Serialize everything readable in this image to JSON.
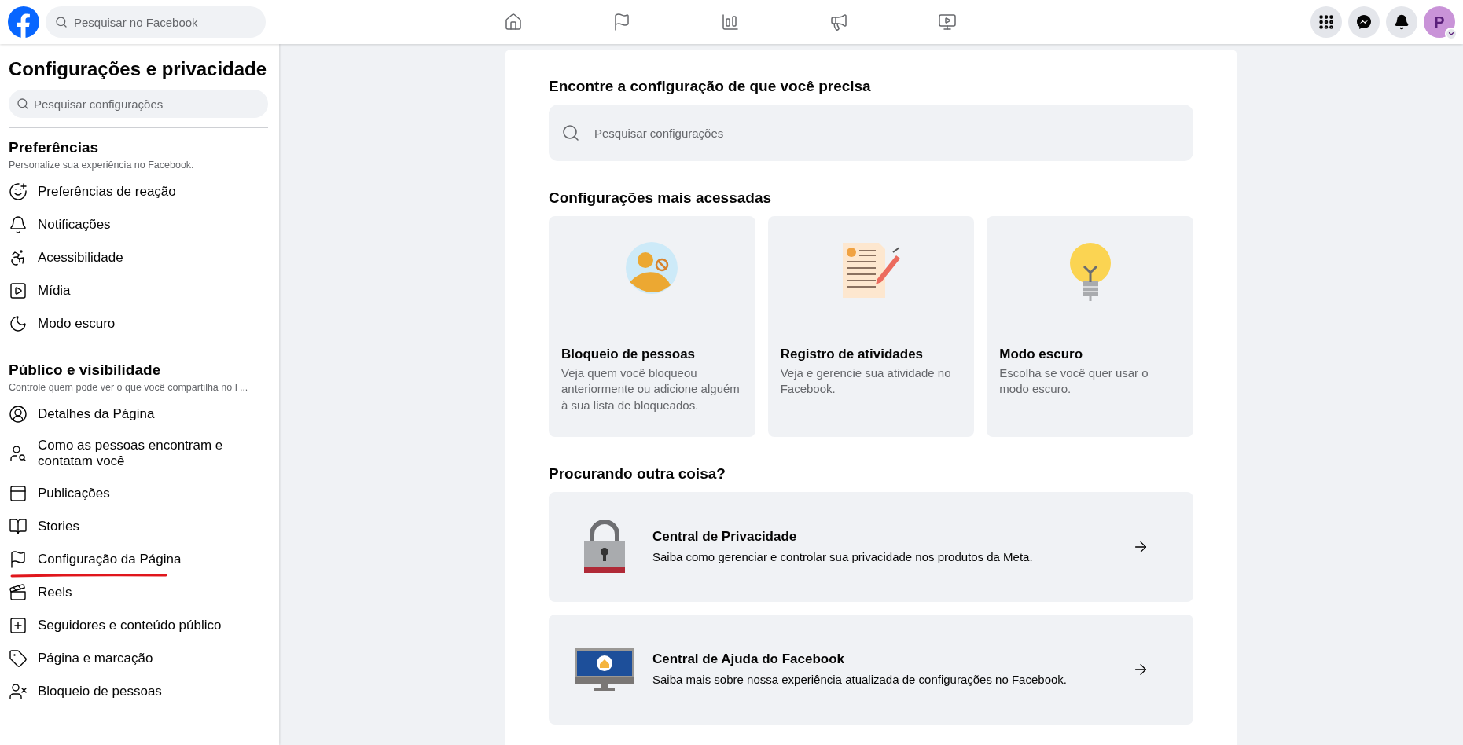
{
  "topbar": {
    "search": {
      "placeholder": "Pesquisar no Facebook"
    },
    "avatar": {
      "initial": "P"
    }
  },
  "sidebar": {
    "title": "Configurações e privacidade",
    "search": {
      "placeholder": "Pesquisar configurações"
    },
    "sections": [
      {
        "title": "Preferências",
        "subtitle": "Personalize sua experiência no Facebook.",
        "items": [
          {
            "label": "Preferências de reação",
            "underlined": false
          },
          {
            "label": "Notificações",
            "underlined": false
          },
          {
            "label": "Acessibilidade",
            "underlined": false
          },
          {
            "label": "Mídia",
            "underlined": false
          },
          {
            "label": "Modo escuro",
            "underlined": false
          }
        ]
      },
      {
        "title": "Público e visibilidade",
        "subtitle": "Controle quem pode ver o que você compartilha no F...",
        "items": [
          {
            "label": "Detalhes da Página",
            "underlined": false
          },
          {
            "label": "Como as pessoas encontram e contatam você",
            "underlined": false
          },
          {
            "label": "Publicações",
            "underlined": false
          },
          {
            "label": "Stories",
            "underlined": false
          },
          {
            "label": "Configuração da Página",
            "underlined": true
          },
          {
            "label": "Reels",
            "underlined": false
          },
          {
            "label": "Seguidores e conteúdo público",
            "underlined": false
          },
          {
            "label": "Página e marcação",
            "underlined": false
          },
          {
            "label": "Bloqueio de pessoas",
            "underlined": false
          }
        ]
      }
    ]
  },
  "main": {
    "find": {
      "title": "Encontre a configuração de que você precisa",
      "search": {
        "placeholder": "Pesquisar configurações"
      }
    },
    "most_accessed": {
      "title": "Configurações mais acessadas",
      "cards": [
        {
          "title": "Bloqueio de pessoas",
          "description": "Veja quem você bloqueou anteriormente ou adicione alguém à sua lista de bloqueados."
        },
        {
          "title": "Registro de atividades",
          "description": "Veja e gerencie sua atividade no Facebook."
        },
        {
          "title": "Modo escuro",
          "description": "Escolha se você quer usar o modo escuro."
        }
      ]
    },
    "other": {
      "title": "Procurando outra coisa?",
      "links": [
        {
          "title": "Central de Privacidade",
          "description": "Saiba como gerenciar e controlar sua privacidade nos produtos da Meta."
        },
        {
          "title": "Central de Ajuda do Facebook",
          "description": "Saiba mais sobre nossa experiência atualizada de configurações no Facebook."
        }
      ]
    }
  }
}
